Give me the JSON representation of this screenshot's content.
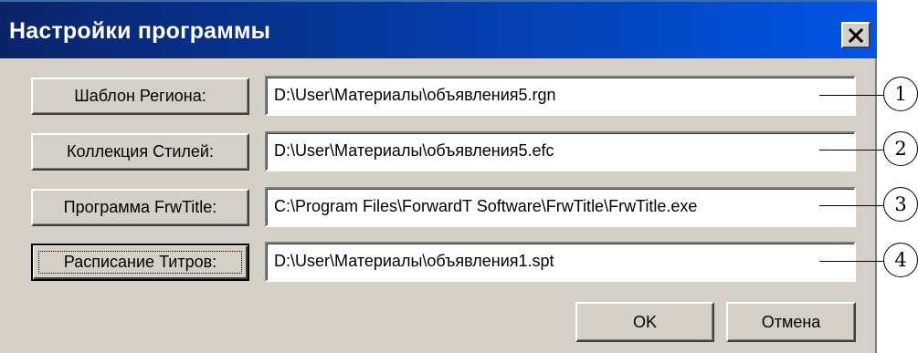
{
  "dialog": {
    "title": "Настройки программы",
    "close_glyph": "✕"
  },
  "rows": [
    {
      "button_label": "Шаблон Региона:",
      "value": "D:\\User\\Материалы\\объявления5.rgn",
      "callout": "1"
    },
    {
      "button_label": "Коллекция Стилей:",
      "value": "D:\\User\\Материалы\\объявления5.efc",
      "callout": "2"
    },
    {
      "button_label": "Программа FrwTitle:",
      "value": "C:\\Program Files\\ForwardT Software\\FrwTitle\\FrwTitle.exe",
      "callout": "3"
    },
    {
      "button_label": "Расписание Титров:",
      "value": "D:\\User\\Материалы\\объявления1.spt",
      "callout": "4"
    }
  ],
  "footer": {
    "ok_label": "OK",
    "cancel_label": "Отмена"
  },
  "icons": {
    "close": "close-icon"
  },
  "colors": {
    "titlebar": "#0055e5",
    "dialog_bg": "#d4d0c8"
  }
}
